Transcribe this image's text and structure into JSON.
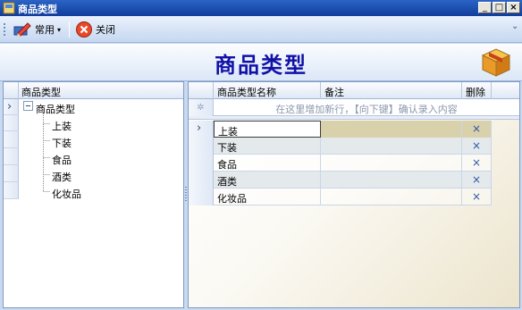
{
  "window": {
    "title": "商品类型",
    "controls": {
      "minimize": "_",
      "maximize": "□",
      "close": "×"
    }
  },
  "toolbar": {
    "common_label": "常用",
    "close_label": "关闭",
    "overflow": "⌄"
  },
  "header": {
    "title": "商品类型"
  },
  "tree": {
    "column_header": "商品类型",
    "expander": "⊟",
    "root": "商品类型",
    "children": [
      "上装",
      "下装",
      "食品",
      "酒类",
      "化妆品"
    ],
    "row_indicator": "›"
  },
  "grid": {
    "columns": [
      "商品类型名称",
      "备注",
      "删除"
    ],
    "new_row_marker": "✲",
    "new_row_hint": "在这里增加新行，【向下键】确认录入内容",
    "row_indicator": "›",
    "delete_glyph": "×",
    "rows": [
      {
        "name": "上装",
        "note": ""
      },
      {
        "name": "下装",
        "note": ""
      },
      {
        "name": "食品",
        "note": ""
      },
      {
        "name": "酒类",
        "note": ""
      },
      {
        "name": "化妆品",
        "note": ""
      }
    ]
  }
}
